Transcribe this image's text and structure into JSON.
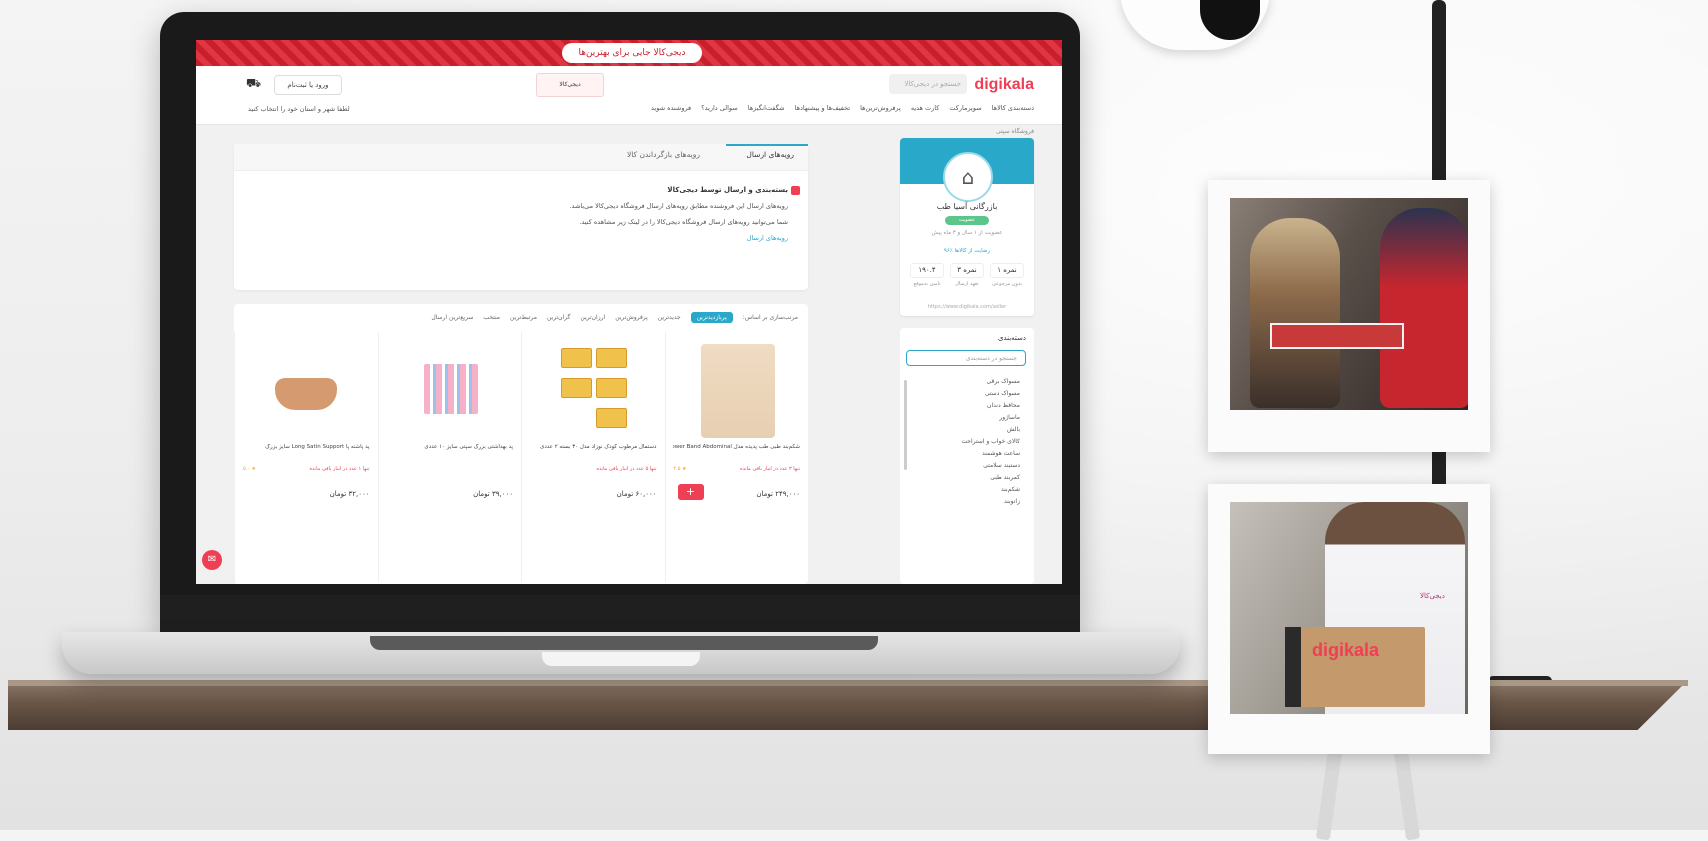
{
  "banner": {
    "text": "دیجی‌کالا جایی برای بهترین‌ها"
  },
  "header": {
    "logo": "digikala",
    "search_placeholder": "جستجو در دیجی‌کالا",
    "promo": "دیجی‌کالا",
    "login": "ورود یا ثبت‌نام",
    "location": "لطفا شهر و استان خود را انتخاب کنید",
    "nav": [
      "دسته‌بندی کالاها",
      "سوپرمارکت",
      "کارت هدیه",
      "پرفروش‌ترین‌ها",
      "تخفیف‌ها و پیشنهادها",
      "شگفت‌انگیزها",
      "سوالی دارید؟",
      "فروشنده شوید"
    ]
  },
  "breadcrumb": "فروشگاه سپتی",
  "seller": {
    "name": "بازرگانی آسیا طب",
    "badge": "عضویت",
    "since": "عضویت از ۱ سال و ۳ ماه پیش",
    "performance": "۹۶٪ رضایت از کالاها",
    "stats": [
      {
        "value": "۱۹۰.۴",
        "label": "تامین به‌موقع"
      },
      {
        "value": "۳ نمره",
        "label": "تعهد ارسال"
      },
      {
        "value": "۱ نمره",
        "label": "بدون مرجوعی"
      }
    ],
    "link": "https://www.digikala.com/seller"
  },
  "tabs": {
    "items": [
      "رویه‌های ارسال",
      "رویه‌های بازگرداندن کالا"
    ],
    "heading": "بسته‌بندی و ارسال توسط دیجی‌کالا",
    "line1": "رویه‌های ارسال این فروشنده مطابق رویه‌های ارسال فروشگاه دیجی‌کالا می‌باشد.",
    "line2": "شما می‌توانید رویه‌های ارسال فروشگاه دیجی‌کالا را در لینک زیر مشاهده کنید.",
    "link": "رویه‌های ارسال"
  },
  "categories": {
    "title": "دسته‌بندی",
    "search_placeholder": "جستجو در دسته‌بندی",
    "items": [
      "مسواک برقی",
      "مسواک دستی",
      "محافظ دندان",
      "ماساژور",
      "بالش",
      "کالای خواب و استراحت",
      "ساعت هوشمند",
      "دستبند سلامتی",
      "کمربند طبی",
      "شکم‌بند",
      "زانوبند"
    ]
  },
  "filters": [
    "مرتب‌سازی بر اساس:",
    "پربازدیدترین",
    "جدیدترین",
    "پرفروش‌ترین",
    "ارزان‌ترین",
    "گران‌ترین",
    "مرتبط‌ترین",
    "منتخب",
    "سریع‌ترین ارسال"
  ],
  "products": [
    {
      "name": "شکم‌بند طبی طب پدیده مدل Power Band Abdominal سایز بزرگ",
      "stock": "تنها ۳ عدد در انبار باقی مانده",
      "rating": "★ ۴.۵",
      "price": "۲۴۹,۰۰۰ تومان",
      "kind": "belt",
      "has_add": true
    },
    {
      "name": "دستمال مرطوب کودک نوزاد مدل ۳۰ بسته ۲ عددی",
      "stock": "تنها ۵ عدد در انبار باقی مانده",
      "rating": "",
      "price": "۶۰,۰۰۰ تومان",
      "kind": "bars",
      "has_add": false
    },
    {
      "name": "پد بهداشتی بزرگ سپتی سایز ۱۰ عددی",
      "stock": "",
      "rating": "",
      "price": "۳۹,۰۰۰ تومان",
      "kind": "pads",
      "has_add": false
    },
    {
      "name": "پد پاشنه پا Long Satin Support سایز بزرگ",
      "stock": "تنها ۱ عدد در انبار باقی مانده",
      "rating": "★ ۵.۰",
      "price": "۳۲,۰۰۰ تومان",
      "kind": "heel",
      "has_add": false
    }
  ],
  "photos": {
    "box_logo": "digikala",
    "shirt_logo": "دیجی‌کالا"
  }
}
